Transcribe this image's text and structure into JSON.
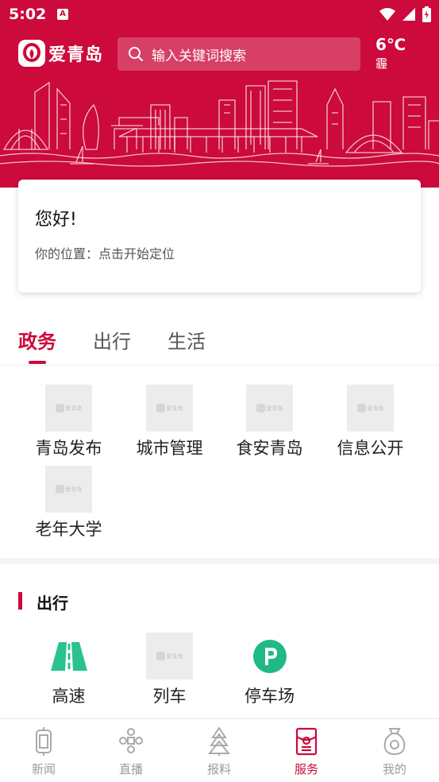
{
  "status_bar": {
    "time": "5:02",
    "app_badge": "A"
  },
  "header": {
    "brand": "爱青岛",
    "search_placeholder": "输入关键词搜索",
    "weather_temp": "6℃",
    "weather_condition": "霾"
  },
  "greeting_card": {
    "title": "您好!",
    "location_text": "你的位置：点击开始定位"
  },
  "tabs": [
    {
      "label": "政务",
      "active": true
    },
    {
      "label": "出行",
      "active": false
    },
    {
      "label": "生活",
      "active": false
    }
  ],
  "government_services": [
    {
      "label": "青岛发布",
      "thumb_text": "爱青岛"
    },
    {
      "label": "城市管理",
      "thumb_text": "爱青岛"
    },
    {
      "label": "食安青岛",
      "thumb_text": "爱青岛"
    },
    {
      "label": "信息公开",
      "thumb_text": "爱青岛"
    },
    {
      "label": "老年大学",
      "thumb_text": "爱青岛"
    }
  ],
  "travel_section": {
    "title": "出行",
    "items": [
      {
        "label": "高速",
        "icon": "highway-icon"
      },
      {
        "label": "列车",
        "icon": "placeholder-thumbnail",
        "thumb_text": "爱青岛"
      },
      {
        "label": "停车场",
        "icon": "parking-icon"
      }
    ]
  },
  "bottom_nav": [
    {
      "label": "新闻",
      "icon": "news-icon",
      "active": false
    },
    {
      "label": "直播",
      "icon": "live-icon",
      "active": false
    },
    {
      "label": "报料",
      "icon": "report-icon",
      "active": false
    },
    {
      "label": "服务",
      "icon": "service-icon",
      "active": true
    },
    {
      "label": "我的",
      "icon": "profile-icon",
      "active": false
    }
  ],
  "colors": {
    "brand_red": "#cc0a3c",
    "highway_green": "#2bc28f",
    "parking_green": "#1fb984",
    "inactive_gray": "#9a9a9a"
  }
}
